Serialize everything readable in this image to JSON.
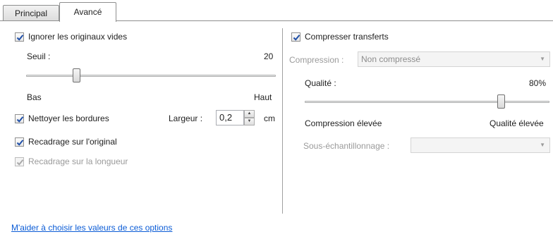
{
  "tabs": [
    {
      "label": "Principal",
      "selected": false
    },
    {
      "label": "Avancé",
      "selected": true
    }
  ],
  "left": {
    "ignore_blank": {
      "label": "Ignorer les originaux vides",
      "checked": true
    },
    "threshold": {
      "label": "Seuil :",
      "value": "20",
      "min_label": "Bas",
      "max_label": "Haut",
      "level": 0.2
    },
    "clean_borders": {
      "label": "Nettoyer les bordures",
      "checked": true
    },
    "width": {
      "label": "Largeur :",
      "value": "0,2",
      "unit": "cm"
    },
    "crop_original": {
      "label": "Recadrage sur l'original",
      "checked": true
    },
    "crop_length": {
      "label": "Recadrage sur la longueur",
      "checked": true,
      "disabled": true
    }
  },
  "right": {
    "compress_transfers": {
      "label": "Compresser transferts",
      "checked": true
    },
    "compression": {
      "label": "Compression :",
      "value": "Non compressé",
      "disabled": true
    },
    "quality": {
      "label": "Qualité :",
      "value": "80%",
      "min_label": "Compression élevée",
      "max_label": "Qualité élevée",
      "level": 0.8
    },
    "subsampling": {
      "label": "Sous-échantillonnage :",
      "value": "",
      "disabled": true
    }
  },
  "help_link": "M'aider à choisir les valeurs de ces options",
  "colors": {
    "accent": "#0b5cd6",
    "check": "#1f4fa8"
  }
}
